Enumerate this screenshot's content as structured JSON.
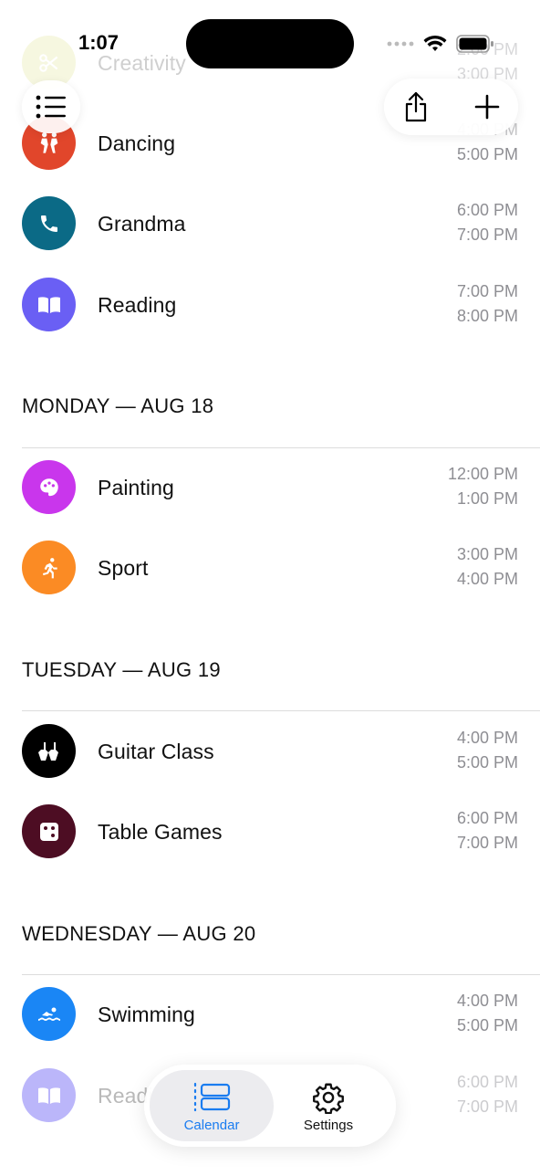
{
  "status_bar": {
    "time": "1:07"
  },
  "top_events": [
    {
      "title": "Creativity",
      "start": "2:00 PM",
      "end": "3:00 PM",
      "color": "#e6e9a8",
      "icon": "scissors-icon"
    },
    {
      "title": "Dancing",
      "start": "4:00 PM",
      "end": "5:00 PM",
      "color": "#e1462b",
      "icon": "dancers-icon"
    },
    {
      "title": "Grandma",
      "start": "6:00 PM",
      "end": "7:00 PM",
      "color": "#0b6a86",
      "icon": "phone-icon"
    },
    {
      "title": "Reading",
      "start": "7:00 PM",
      "end": "8:00 PM",
      "color": "#6a5ff4",
      "icon": "book-icon"
    }
  ],
  "days": [
    {
      "header": "MONDAY — AUG 18",
      "events": [
        {
          "title": "Painting",
          "start": "12:00 PM",
          "end": "1:00 PM",
          "color": "#c936ec",
          "icon": "palette-icon"
        },
        {
          "title": "Sport",
          "start": "3:00 PM",
          "end": "4:00 PM",
          "color": "#fb8b24",
          "icon": "runner-icon"
        }
      ]
    },
    {
      "header": "TUESDAY — AUG 19",
      "events": [
        {
          "title": "Guitar Class",
          "start": "4:00 PM",
          "end": "5:00 PM",
          "color": "#000000",
          "icon": "guitars-icon"
        },
        {
          "title": "Table Games",
          "start": "6:00 PM",
          "end": "7:00 PM",
          "color": "#4d0d23",
          "icon": "dice-icon"
        }
      ]
    },
    {
      "header": "WEDNESDAY — AUG 20",
      "events": [
        {
          "title": "Swimming",
          "start": "4:00 PM",
          "end": "5:00 PM",
          "color": "#1a86f5",
          "icon": "swimmer-icon"
        },
        {
          "title": "Reading",
          "start": "6:00 PM",
          "end": "7:00 PM",
          "color": "#6a5ff4",
          "icon": "book-icon"
        }
      ]
    }
  ],
  "tabs": [
    {
      "label": "Calendar",
      "icon": "calendar-list-icon",
      "active": true,
      "color": "#1a7cf0"
    },
    {
      "label": "Settings",
      "icon": "gear-icon",
      "active": false,
      "color": "#111111"
    }
  ]
}
